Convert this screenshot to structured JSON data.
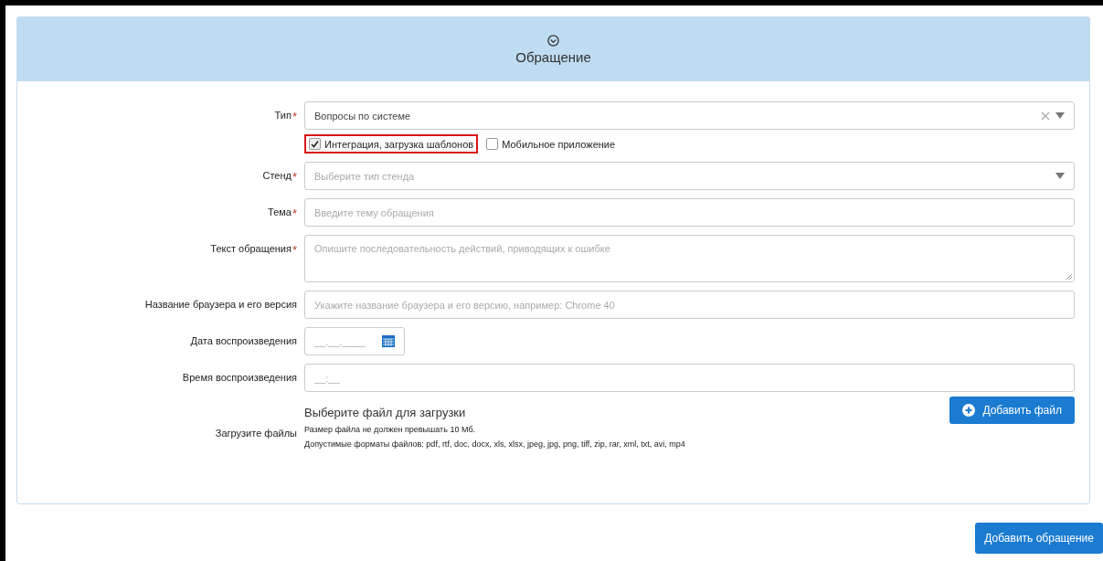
{
  "panel": {
    "title": "Обращение",
    "expanded": true
  },
  "fields": [
    {
      "kind": "select",
      "label": "Тип",
      "required_mark": "*",
      "value": "Вопросы по системе",
      "clearable": true
    },
    {
      "kind": "checkboxes",
      "options": [
        {
          "label": "Интеграция, загрузка шаблонов",
          "checked": true,
          "highlighted": true
        },
        {
          "label": "Мобильное приложение",
          "checked": false,
          "highlighted": false
        }
      ]
    },
    {
      "kind": "select",
      "label": "Стенд",
      "required_mark": "*",
      "placeholder": "Выберите тип стенда",
      "clearable": false
    },
    {
      "kind": "text",
      "label": "Тема",
      "required_mark": "*",
      "placeholder": "Введите тему обращения"
    },
    {
      "kind": "textarea",
      "label": "Текст обращения",
      "required_mark": "*",
      "placeholder": "Опишите последовательность действий, приводящих к ошибке"
    },
    {
      "kind": "text",
      "label": "Название браузера и его версия",
      "placeholder": "Укажите название браузера и его версию, например: Chrome 40"
    },
    {
      "kind": "date",
      "label": "Дата воспроизведения",
      "placeholder": "__.__.____"
    },
    {
      "kind": "text",
      "label": "Время воспроизведения",
      "placeholder": "__:__"
    },
    {
      "kind": "upload",
      "label": "Загрузите файлы",
      "title": "Выберите файл для загрузки",
      "notes": [
        "Размер файла не должен превышать 10 Мб.",
        "Допустимые форматы файлов: pdf, rtf, doc, docx, xls, xlsx, jpeg, jpg, png, tiff, zip, rar, xml, txt, avi, mp4"
      ],
      "button": "Добавить файл"
    }
  ],
  "submit": "Добавить обращение"
}
